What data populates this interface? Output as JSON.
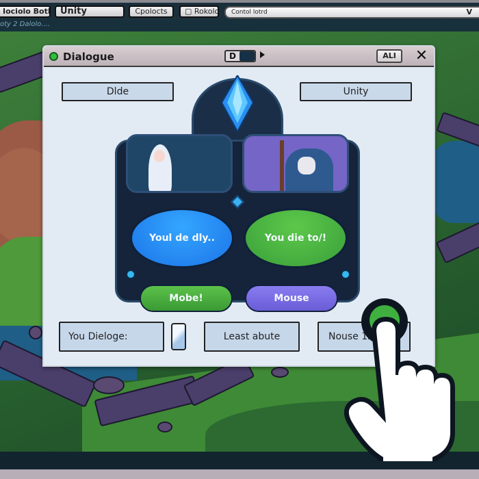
{
  "editor": {
    "toolbar": {
      "buttons": [
        {
          "label": "Iociolo Botlol"
        },
        {
          "label": "Unity"
        },
        {
          "label": "Cpolocts"
        },
        {
          "label": "Rokolo )"
        }
      ],
      "search": {
        "value": "Contol lotrd",
        "chevron": "V"
      }
    },
    "subbar": {
      "text": "oty 2 Dalolo...."
    }
  },
  "dialog": {
    "title": "Dialogue",
    "status_color": "#2fc03a",
    "mode_toggle": {
      "label": "D"
    },
    "all_button": "ALI",
    "close_symbol": "✕",
    "top_fields": {
      "left": "Dlde",
      "right": "Unity"
    },
    "speakers": [
      {
        "name": "elf",
        "bubble_text": "Youl de dly..",
        "bubble_color": "#1f8cf5"
      },
      {
        "name": "wizard",
        "bubble_text": "You die to/!",
        "bubble_color": "#4cb63e"
      }
    ],
    "choices": [
      {
        "label": "Mobe!",
        "color": "#4cb03e"
      },
      {
        "label": "Mouse",
        "color": "#7a6ce4"
      }
    ],
    "bottom_fields": {
      "dialogue_label": "You Dieloge:",
      "middle": "Least abute",
      "right": "Nouse 1X"
    }
  },
  "cursor": {
    "type": "pointing-hand",
    "click_indicator_color": "#3fb040"
  }
}
